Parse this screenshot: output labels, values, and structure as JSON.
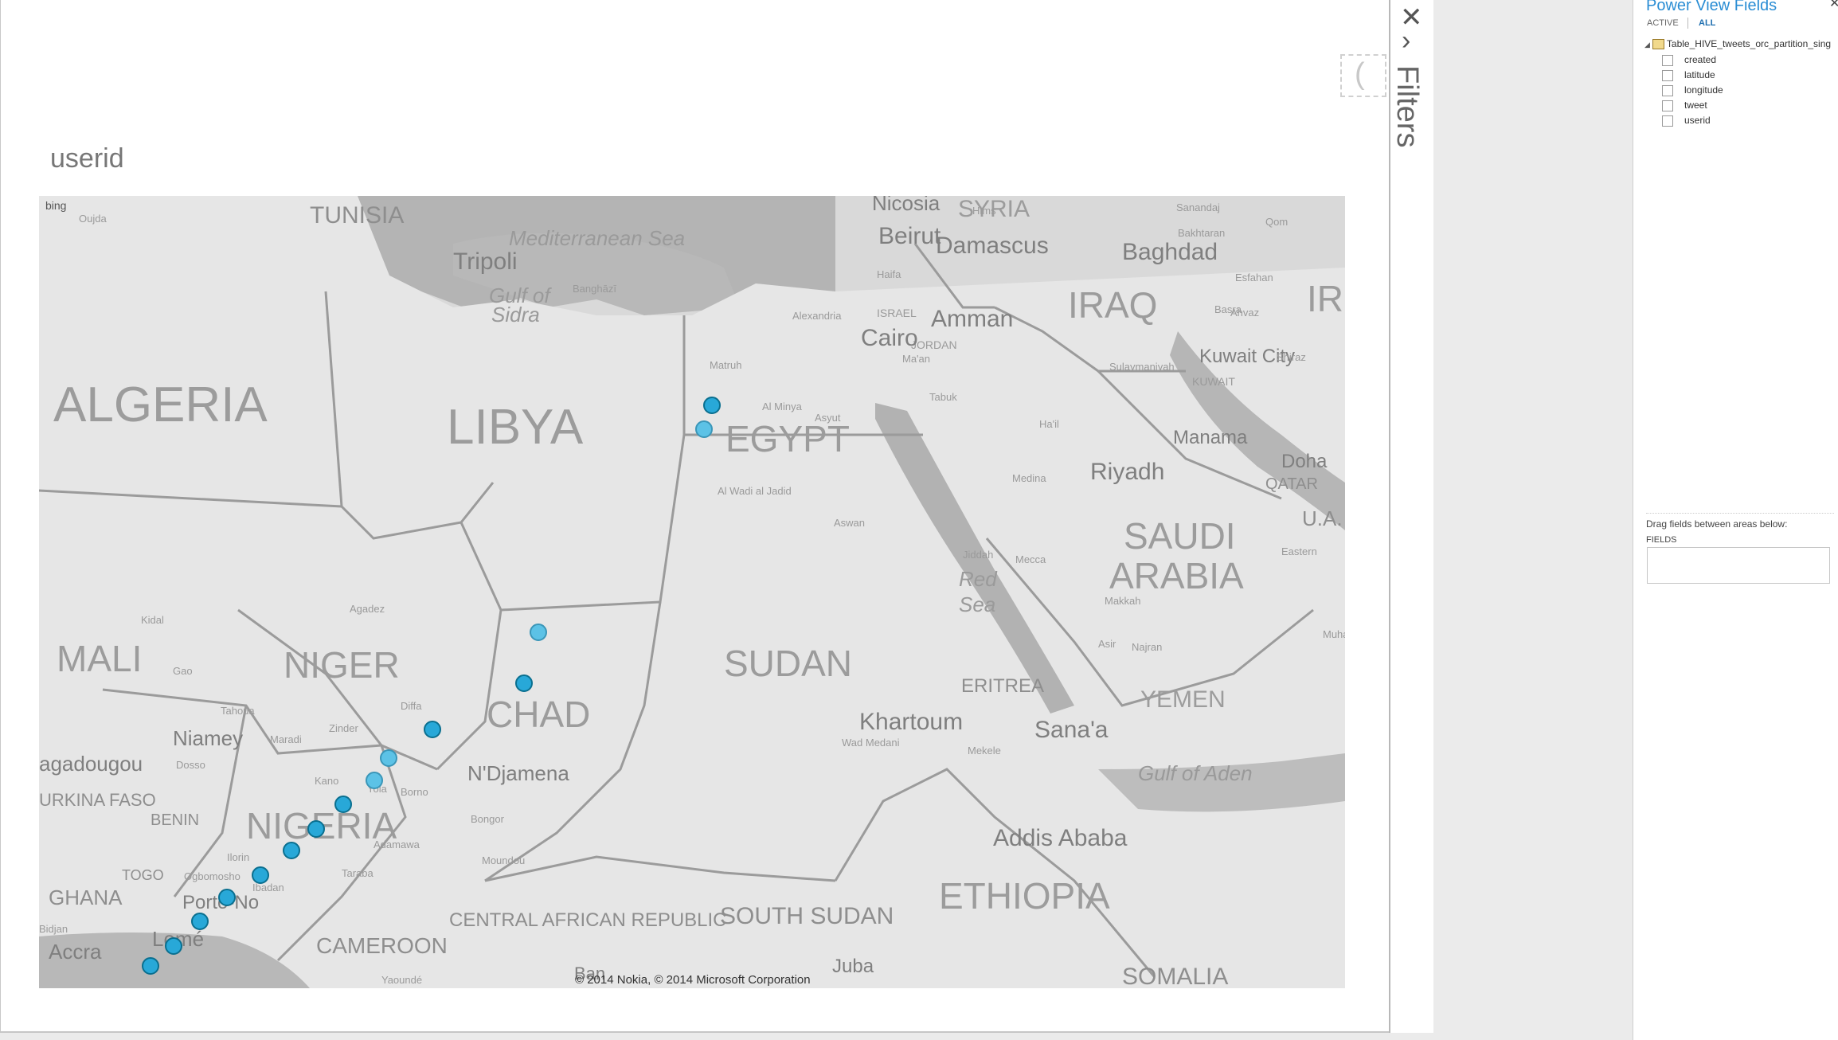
{
  "canvas": {
    "visualization_title": "userid",
    "placeholder_glyph": "("
  },
  "map": {
    "provider_badge": "bing",
    "copyright": "© 2014 Nokia, © 2014 Microsoft Corporation",
    "countries": {
      "algeria": "ALGERIA",
      "libya": "LIBYA",
      "egypt": "EGYPT",
      "niger": "NIGER",
      "mali": "MALI",
      "chad": "CHAD",
      "sudan": "SUDAN",
      "nigeria": "NIGERIA",
      "iraq": "IRAQ",
      "syria": "SYRIA",
      "saudi_arabia_line1": "SAUDI",
      "saudi_arabia_line2": "ARABIA",
      "yemen": "YEMEN",
      "ethiopia": "ETHIOPIA",
      "eritrea": "ERITREA",
      "tunisia": "TUNISIA",
      "ghana": "GHANA",
      "togo": "TOGO",
      "benin": "BENIN",
      "cameroon": "CAMEROON",
      "car": "CENTRAL AFRICAN REPUBLIC",
      "south_sudan": "SOUTH SUDAN",
      "somalia": "SOMALIA",
      "jordan": "JORDAN",
      "israel": "ISRAEL",
      "kuwait": "KUWAIT",
      "qatar": "QATAR",
      "burkina": "URKINA FASO",
      "iran_partial": "IR",
      "uae_partial": "U.A."
    },
    "cities": {
      "tripoli": "Tripoli",
      "cairo": "Cairo",
      "beirut": "Beirut",
      "damascus": "Damascus",
      "amman": "Amman",
      "baghdad": "Baghdad",
      "kuwait_city": "Kuwait City",
      "riyadh": "Riyadh",
      "manama": "Manama",
      "doha": "Doha",
      "khartoum": "Khartoum",
      "sanaa": "Sana'a",
      "addis_ababa": "Addis Ababa",
      "niamey": "Niamey",
      "ndjamena": "N'Djamena",
      "ouagadougou": "agadougou",
      "porto_novo": "Porto-No",
      "lome": "Lomé",
      "accra": "Accra",
      "juba": "Juba",
      "nicosia": "Nicosia",
      "bangui": "Ban"
    },
    "seas": {
      "mediterranean": "Mediterranean Sea",
      "gulf_sidra_1": "Gulf of",
      "gulf_sidra_2": "Sidra",
      "red_sea_1": "Red",
      "red_sea_2": "Sea",
      "gulf_aden": "Gulf of Aden"
    },
    "small_labels": {
      "benghazi": "Banghāzī",
      "matruh": "Matruh",
      "al_wadi": "Al Wadi al Jadid",
      "asyut": "Asyut",
      "al_minya": "Al Minya",
      "aswan": "Aswan",
      "agadez": "Agadez",
      "tahoua": "Tahoua",
      "kano": "Kano",
      "kidal": "Kidal",
      "gao": "Gao",
      "mecca": "Mecca",
      "medina": "Medina",
      "jiddah": "Jiddah",
      "tabuk": "Tabuk",
      "hail": "Ha'il",
      "mosul": "Sulaymaniyah",
      "basra": "Basra",
      "mekele": "Mekele",
      "moundou": "Moundou",
      "bongor": "Bongor",
      "yaounde": "Yaoundé",
      "diffa": "Diffa",
      "zinder": "Zinder",
      "maradi": "Maradi",
      "dosso": "Dosso",
      "yola": "Yola",
      "borno": "Borno",
      "wad_madani": "Wad Medani",
      "ogbomosho": "Ogbomosho",
      "taraba": "Taraba",
      "ibadan": "Ibadan",
      "ilorin": "Ilorin",
      "adamawa": "Adamawa",
      "bouaké": "Bidjan",
      "makkah_area": "Makkah",
      "asir": "Asir",
      "najran": "Najran",
      "eastern": "Eastern",
      "muscat_partial": "Muha",
      "sanandaj": "Sanandaj",
      "bakhtaran": "Bakhtaran",
      "qom": "Qom",
      "esfahan": "Esfahan",
      "ahvaz": "Ahvaz",
      "shiraz": "Shiraz",
      "hims": "Hims",
      "haifa": "Haifa",
      "ma_an": "Ma'an",
      "alexandria": "Alexandria",
      "oujda": "Oujda"
    },
    "tweet_points": [
      {
        "id": "egypt-1",
        "lat": 26.8,
        "lon": 28.9,
        "pale": false
      },
      {
        "id": "egypt-2",
        "lat": 25.7,
        "lon": 28.5,
        "pale": true
      },
      {
        "id": "chad-1",
        "lat": 16.5,
        "lon": 20.5,
        "pale": true
      },
      {
        "id": "chad-2",
        "lat": 14.2,
        "lon": 19.8,
        "pale": false
      },
      {
        "id": "chad-3",
        "lat": 12.1,
        "lon": 15.4,
        "pale": false
      },
      {
        "id": "nigeria-1",
        "lat": 10.8,
        "lon": 13.3,
        "pale": true
      },
      {
        "id": "nigeria-2",
        "lat": 9.8,
        "lon": 12.6,
        "pale": true
      },
      {
        "id": "nigeria-3",
        "lat": 8.7,
        "lon": 11.1,
        "pale": false
      },
      {
        "id": "nigeria-4",
        "lat": 7.6,
        "lon": 9.8,
        "pale": false
      },
      {
        "id": "nigeria-5",
        "lat": 6.6,
        "lon": 8.6,
        "pale": false
      },
      {
        "id": "nigeria-6",
        "lat": 5.5,
        "lon": 7.1,
        "pale": false
      },
      {
        "id": "nigeria-7",
        "lat": 4.5,
        "lon": 5.5,
        "pale": false
      },
      {
        "id": "gulf-1",
        "lat": 3.4,
        "lon": 4.2,
        "pale": false
      },
      {
        "id": "gulf-2",
        "lat": 2.3,
        "lon": 2.9,
        "pale": false
      },
      {
        "id": "gulf-3",
        "lat": 1.4,
        "lon": 1.8,
        "pale": false
      }
    ],
    "point_color": "#28a8d8",
    "point_color_pale": "#5cc2e6"
  },
  "filters": {
    "label": "Filters",
    "close_glyph": "✕",
    "expand_glyph": "›"
  },
  "fields_panel": {
    "title": "Power View Fields",
    "close_glyph": "✕",
    "tabs": {
      "active": "ACTIVE",
      "all": "ALL"
    },
    "table_name": "Table_HIVE_tweets_orc_partition_sing",
    "fields": [
      "created",
      "latitude",
      "longitude",
      "tweet",
      "userid"
    ],
    "drag_hint": "Drag fields between areas below:",
    "fields_area_label": "FIELDS"
  }
}
